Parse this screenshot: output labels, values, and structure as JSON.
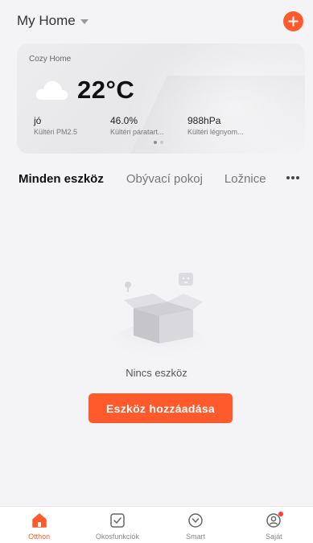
{
  "header": {
    "home_title": "My Home",
    "icons": {
      "caret": "chevron-down-icon",
      "add": "plus-icon"
    },
    "accent_color": "#ff5a2c"
  },
  "weather": {
    "location_label": "Cozy Home",
    "icon": "cloud-icon",
    "temperature": "22°C",
    "stats": [
      {
        "value": "jó",
        "label": "Kültéri PM2.5"
      },
      {
        "value": "46.0%",
        "label": "Kültéri páratart..."
      },
      {
        "value": "988hPa",
        "label": "Kültéri légnyom..."
      }
    ],
    "pager": {
      "pages": 2,
      "active": 1
    }
  },
  "rooms": {
    "tabs": [
      "Minden eszköz",
      "Obývací pokoj",
      "Ložnice"
    ],
    "active_index": 0,
    "more_icon": "more-dots-icon"
  },
  "empty_state": {
    "illustration": "empty-box-icon",
    "text": "Nincs eszköz",
    "button_label": "Eszköz hozzáadása"
  },
  "tabbar": {
    "items": [
      {
        "label": "Otthon",
        "icon": "home-icon",
        "active": true
      },
      {
        "label": "Okosfunkciók",
        "icon": "checkbox-icon",
        "active": false
      },
      {
        "label": "Smart",
        "icon": "smart-icon",
        "active": false
      },
      {
        "label": "Saját",
        "icon": "profile-icon",
        "active": false,
        "badge": true
      }
    ]
  }
}
